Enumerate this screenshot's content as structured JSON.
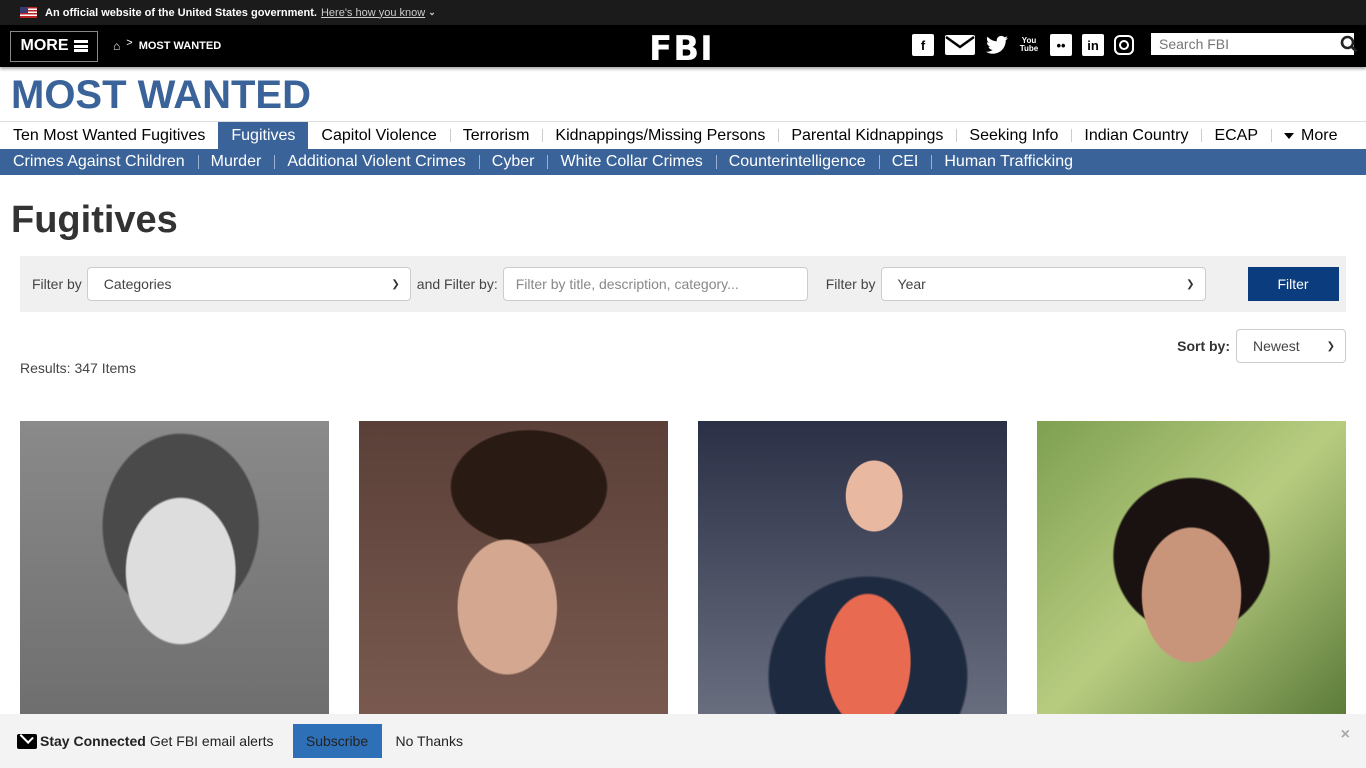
{
  "gov_banner": {
    "text": "An official website of the United States government.",
    "link": "Here's how you know"
  },
  "header": {
    "more_label": "MORE",
    "breadcrumb": "MOST WANTED",
    "logo": "FBI",
    "social": [
      "facebook",
      "email",
      "twitter",
      "youtube",
      "flickr",
      "linkedin",
      "instagram"
    ],
    "search_placeholder": "Search FBI"
  },
  "site_title": "MOST WANTED",
  "nav_primary": [
    {
      "label": "Ten Most Wanted Fugitives",
      "active": false
    },
    {
      "label": "Fugitives",
      "active": true
    },
    {
      "label": "Capitol Violence",
      "active": false
    },
    {
      "label": "Terrorism",
      "active": false
    },
    {
      "label": "Kidnappings/Missing Persons",
      "active": false
    },
    {
      "label": "Parental Kidnappings",
      "active": false
    },
    {
      "label": "Seeking Info",
      "active": false
    },
    {
      "label": "Indian Country",
      "active": false
    },
    {
      "label": "ECAP",
      "active": false
    },
    {
      "label": "More",
      "active": false
    }
  ],
  "nav_secondary": [
    "Crimes Against Children",
    "Murder",
    "Additional Violent Crimes",
    "Cyber",
    "White Collar Crimes",
    "Counterintelligence",
    "CEI",
    "Human Trafficking"
  ],
  "page_title": "Fugitives",
  "filters": {
    "label1": "Filter by",
    "category_value": "Categories",
    "label2": "and Filter by:",
    "text_placeholder": "Filter by title, description, category...",
    "label3": "Filter by",
    "year_value": "Year",
    "button": "Filter"
  },
  "sort": {
    "label": "Sort by:",
    "value": "Newest"
  },
  "results": "Results: 347 Items",
  "cards": [
    {
      "photo": "fugitive-photo-1"
    },
    {
      "photo": "fugitive-photo-2"
    },
    {
      "photo": "fugitive-photo-3"
    },
    {
      "photo": "fugitive-photo-4"
    }
  ],
  "stay_connected": {
    "title": "Stay Connected",
    "text": "Get FBI email alerts",
    "subscribe": "Subscribe",
    "no_thanks": "No Thanks",
    "close": "×"
  },
  "colors": {
    "brand_blue": "#3a6399",
    "filter_button": "#0b3c7d",
    "subscribe": "#2e70b8"
  }
}
